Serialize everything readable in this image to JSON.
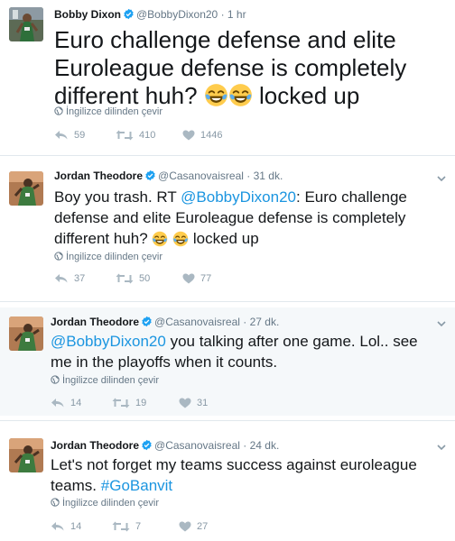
{
  "tweets": [
    {
      "name": "Bobby Dixon",
      "handle": "@BobbyDixon20",
      "dot": "·",
      "time": "1 hr",
      "text_before": "Euro challenge defense and elite Euroleague defense is completely different huh?",
      "text_after": "locked up",
      "translate": "İngilizce dilinden çevir",
      "reply_count": "59",
      "retweet_count": "410",
      "like_count": "1446"
    },
    {
      "name": "Jordan Theodore",
      "handle": "@Casanovaisreal",
      "dot": "·",
      "time": "31 dk.",
      "text_before": "Boy you trash. RT",
      "mention": "@BobbyDixon20",
      "text_middle": ": Euro challenge defense and elite Euroleague defense is completely different huh?",
      "text_after": "locked up",
      "translate": "İngilizce dilinden çevir",
      "reply_count": "37",
      "retweet_count": "50",
      "like_count": "77"
    },
    {
      "name": "Jordan Theodore",
      "handle": "@Casanovaisreal",
      "dot": "·",
      "time": "27 dk.",
      "mention": "@BobbyDixon20",
      "text_after": " you talking after one game. Lol.. see me in the playoffs when it counts.",
      "translate": "İngilizce dilinden çevir",
      "reply_count": "14",
      "retweet_count": "19",
      "like_count": "31"
    },
    {
      "name": "Jordan Theodore",
      "handle": "@Casanovaisreal",
      "dot": "·",
      "time": "24 dk.",
      "text_before": "Let's not forget my teams success against euroleague teams.",
      "hashtag": "#GoBanvit",
      "translate": "İngilizce dilinden çevir",
      "reply_count": "14",
      "retweet_count": "7",
      "like_count": "27"
    }
  ],
  "icons": {
    "verified": "verified-badge-icon",
    "globe": "globe-icon",
    "reply": "reply-icon",
    "retweet": "retweet-icon",
    "like": "heart-icon",
    "caret": "chevron-down-icon",
    "emoji": "face-with-tears-of-joy-emoji"
  },
  "colors": {
    "link": "#1b95e0",
    "verified": "#1da1f2",
    "muted": "#657786",
    "action": "#8899a6",
    "highlight_bg": "#f5f8fa"
  }
}
